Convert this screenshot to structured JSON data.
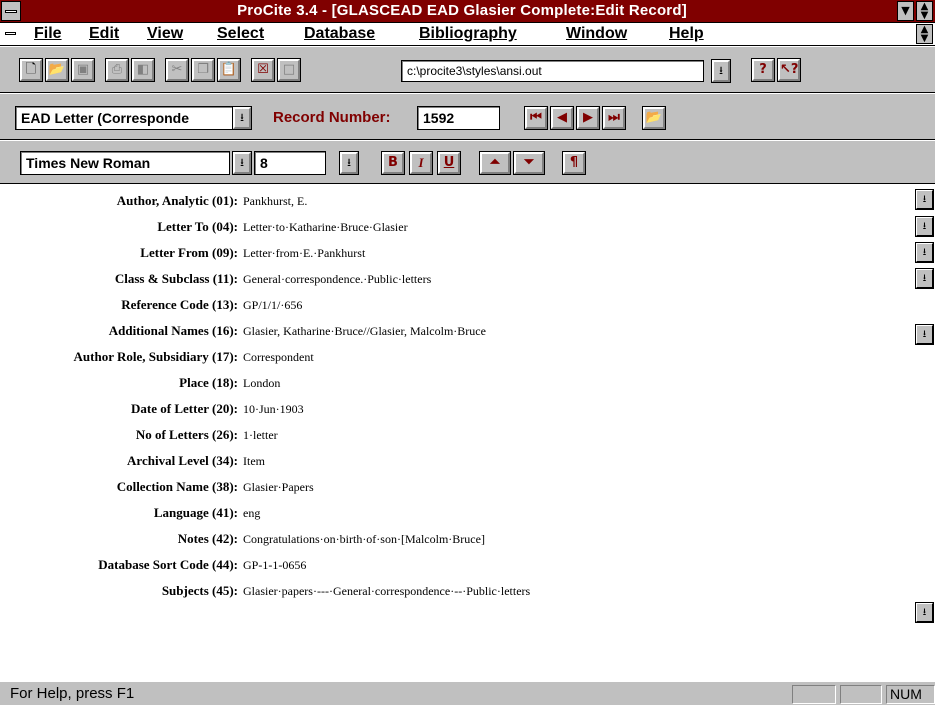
{
  "window": {
    "title": "ProCite 3.4 - [GLASCEAD EAD Glasier Complete:Edit Record]",
    "title_color": "#800000"
  },
  "menu": [
    {
      "label": "File",
      "icon": "doc-control-icon"
    },
    {
      "label": "Edit"
    },
    {
      "label": "View"
    },
    {
      "label": "Select"
    },
    {
      "label": "Database"
    },
    {
      "label": "Bibliography"
    },
    {
      "label": "Window"
    },
    {
      "label": "Help"
    }
  ],
  "toolbar": {
    "style_path": "c:\\procite3\\styles\\ansi.out",
    "buttons": [
      "new-icon",
      "open-icon",
      "save-icon",
      "print-icon",
      "print-preview-icon",
      "cut-icon",
      "copy-icon",
      "paste-icon",
      "delete-icon",
      "blank-icon",
      "help-icon",
      "context-help-icon"
    ]
  },
  "record_bar": {
    "workform": "EAD Letter (Corresponde",
    "record_number_label": "Record Number:",
    "record_number": "1592"
  },
  "format_bar": {
    "font": "Times New Roman",
    "size": "8",
    "bold": "B",
    "italic": "I",
    "underline": "U",
    "paragraph": "¶"
  },
  "fields": [
    {
      "label": "Author, Analytic (01):",
      "value": "Pankhurst, E.",
      "has_list": true
    },
    {
      "label": "Letter To (04):",
      "value": "Letter·to·Katharine·Bruce·Glasier",
      "has_list": true
    },
    {
      "label": "Letter From (09):",
      "value": "Letter·from·E.·Pankhurst",
      "has_list": true
    },
    {
      "label": "Class & Subclass (11):",
      "value": "General·correspondence.·Public·letters",
      "has_list": true
    },
    {
      "label": "Reference Code (13):",
      "value": "GP/1/1/·656",
      "has_list": false
    },
    {
      "label": "Additional Names (16):",
      "value": "Glasier, Katharine·Bruce//Glasier, Malcolm·Bruce",
      "has_list": true
    },
    {
      "label": "Author Role, Subsidiary (17):",
      "value": "Correspondent",
      "has_list": false
    },
    {
      "label": "Place (18):",
      "value": "London",
      "has_list": false
    },
    {
      "label": "Date of Letter (20):",
      "value": "10·Jun·1903",
      "has_list": false
    },
    {
      "label": "No of Letters (26):",
      "value": "1·letter",
      "has_list": false
    },
    {
      "label": "Archival Level (34):",
      "value": "Item",
      "has_list": false
    },
    {
      "label": "Collection Name (38):",
      "value": "Glasier·Papers",
      "has_list": false
    },
    {
      "label": "Language (41):",
      "value": "eng",
      "has_list": false
    },
    {
      "label": "Notes (42):",
      "value": "Congratulations·on·birth·of·son·[Malcolm·Bruce]",
      "has_list": false
    },
    {
      "label": "Database Sort Code (44):",
      "value": "GP-1-1-0656",
      "has_list": false
    },
    {
      "label": "Subjects (45):",
      "value": "Glasier·papers·---·General·correspondence·--·Public·letters",
      "has_list": true
    }
  ],
  "status": {
    "help_text": "For Help, press F1",
    "num": "NUM"
  }
}
